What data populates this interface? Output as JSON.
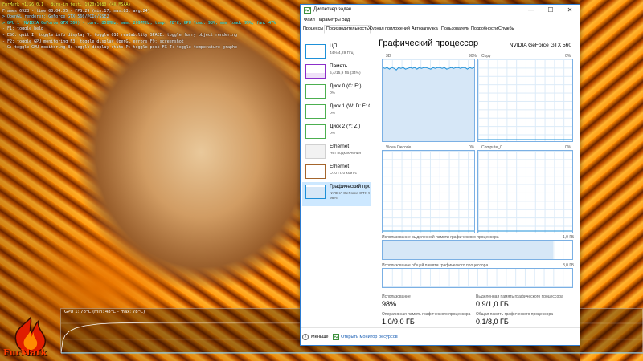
{
  "furmark": {
    "hud_lines": [
      "FurMark v1.26.0.1 - Burn-in test, 1920x1080 (4X MSAA)",
      "Frames:6928 - time:00:04:05 - FPS:29 (min:17, max:83, avg:24)",
      "> OpenGL renderer: GeForce GTX 560/PCIe/SSE2",
      "> GPU 1 (NVIDIA GeForce GTX 560) - core: 850MHz, mem: 2097MHz, temp: 78°C, GPU load: 98%, mem load: 95%, fan: 47%",
      "- F1: toggle help",
      "- ESC: quit   I: toggle info display   V: toggle OSI readability   SPACE: toggle furry object rendering",
      "- F2: toggle GPU monitoring   F3: toggle display OpenGL errors   F9: screenshot",
      "- G: toggle GPU monitoring   B: toggle display stats   P: toggle post-FX   T: toggle temperature graphe"
    ],
    "gpu_graph_label": "GPU 1: 78°C (min: 48°C - max: 78°C)",
    "logo_text": "FurMark"
  },
  "window": {
    "title": "Диспетчер задач",
    "minimize": "—",
    "maximize": "☐",
    "close": "✕"
  },
  "menu": [
    "Файл",
    "Параметры",
    "Вид"
  ],
  "tabs": [
    "Процессы",
    "Производительность",
    "Журнал приложений",
    "Автозагрузка",
    "Пользователи",
    "Подробности",
    "Службы"
  ],
  "active_tab": "Производительность",
  "sidebar": [
    {
      "name": "ЦП",
      "sub": "44%  4,29 ГГц",
      "color": "#1e90d8"
    },
    {
      "name": "Память",
      "sub": "5,4/15,9 ГБ (34%)",
      "color": "#8b2fc9"
    },
    {
      "name": "Диск 0 (C: E:)",
      "sub": "0%",
      "color": "#4caf50"
    },
    {
      "name": "Диск 1 (W: D: F: G:",
      "sub": "0%",
      "color": "#4caf50"
    },
    {
      "name": "Диск 2 (Y: Z:)",
      "sub": "0%",
      "color": "#4caf50"
    },
    {
      "name": "Ethernet",
      "sub": "Нет подключения",
      "color": "#aaaaaa"
    },
    {
      "name": "Ethernet",
      "sub": "О: 0  П: 0 кбит/с",
      "color": "#a4652c"
    },
    {
      "name": "Графический проц",
      "sub": "NVIDIA GeForce GTX 560",
      "sub2": "98%",
      "color": "#1e90d8"
    }
  ],
  "main": {
    "title": "Графический процессор",
    "gpu_name": "NVIDIA GeForce GTX 560",
    "engines": [
      {
        "name": "3D",
        "max": "90%",
        "load": 0.9
      },
      {
        "name": "Copy",
        "max": "0%",
        "load": 0
      },
      {
        "name": "Video Decode",
        "max": "0%",
        "load": 0
      },
      {
        "name": "Compute_0",
        "max": "0%",
        "load": 0
      }
    ],
    "dedicated_mem_label": "Использование выделенной памяти графического процессора",
    "dedicated_mem_max": "1,0 ГБ",
    "dedicated_mem_fraction": 0.9,
    "shared_mem_label": "Использование общей памяти графического процессора",
    "shared_mem_max": "8,0 ГБ",
    "shared_mem_fraction": 0.0125,
    "stats": {
      "usage_label": "Использование",
      "usage_value": "98%",
      "dedicated_label": "Выделенная память графического процессора",
      "dedicated_value": "0,9/1,0 ГБ",
      "gpu_mem_label": "Оперативная память графического процессора",
      "gpu_mem_value": "1,0/9,0 ГБ",
      "shared_label": "Общая память графического процессора",
      "shared_value": "0,1/8,0 ГБ"
    }
  },
  "footer": {
    "less": "Меньше",
    "resource_monitor": "Открыть монитор ресурсов"
  },
  "colors": {
    "accent": "#1e90d8",
    "graph_border": "#7bb0e4",
    "selected_bg": "#cde8ff"
  }
}
